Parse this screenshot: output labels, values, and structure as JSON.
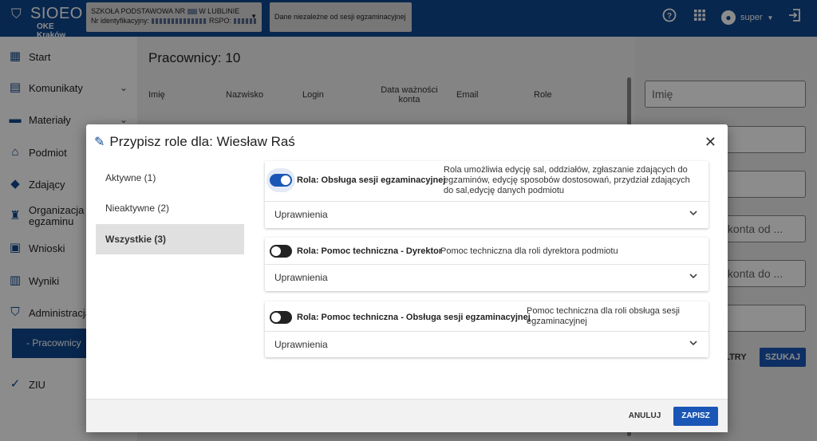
{
  "app": {
    "name": "SIOEO",
    "org": "OKE Kraków",
    "logo_icon": "shield-book-icon"
  },
  "header": {
    "school_line1": "SZKOŁA PODSTAWOWA NR ",
    "school_line1_suffix": " W LUBLINIE",
    "school_line2_prefix": "Nr identyfikacyjny: ",
    "school_line2_rspo": " RSPO: ",
    "exam_selector": "Dane niezależne od sesji egzaminacyjnej",
    "user_name": "super",
    "icons": [
      "help-icon",
      "apps-grid-icon",
      "account-icon",
      "logout-icon"
    ]
  },
  "sidebar": {
    "items": [
      {
        "label": "Start",
        "icon": "dashboard-icon"
      },
      {
        "label": "Komunikaty",
        "icon": "message-icon",
        "expandable": true
      },
      {
        "label": "Materiały",
        "icon": "folder-icon",
        "expandable": true
      },
      {
        "label": "Podmiot",
        "icon": "institution-icon"
      },
      {
        "label": "Zdający",
        "icon": "graduation-cap-icon"
      },
      {
        "label": "Organizacja",
        "label2": "egzaminu",
        "icon": "organization-icon"
      },
      {
        "label": "Wnioski",
        "icon": "clipboard-icon"
      },
      {
        "label": "Wyniki",
        "icon": "bar-chart-icon"
      },
      {
        "label": "Administracja",
        "icon": "shield-admin-icon"
      },
      {
        "label": "ZIU",
        "icon": "verified-icon"
      }
    ],
    "active_sub": "- Pracownicy"
  },
  "main": {
    "title": "Pracownicy: 10",
    "columns": [
      "Imię",
      "Nazwisko",
      "Login",
      "Data ważności konta",
      "Email",
      "Role"
    ]
  },
  "filters": {
    "fields": [
      "Imię",
      "",
      "",
      "Data ważności konta od ...",
      "Data ważności konta do ...",
      ""
    ],
    "clear_button": "WYCZYŚĆ FILTRY",
    "search_button": "SZUKAJ"
  },
  "modal": {
    "title": "Przypisz role dla: Wiesław Raś",
    "tabs": [
      {
        "label": "Aktywne (1)",
        "active": false
      },
      {
        "label": "Nieaktywne (2)",
        "active": false
      },
      {
        "label": "Wszystkie (3)",
        "active": true
      }
    ],
    "roles": [
      {
        "name": "Rola: Obsługa sesji egzaminacyjnej",
        "enabled": true,
        "description": "Rola umożliwia edycję sal, oddziałów, zgłaszanie zdających do egzaminów, edycję sposobów dostosowań, przydział zdających do sal,edycję danych podmiotu",
        "permissions_label": "Uprawnienia"
      },
      {
        "name": "Rola: Pomoc techniczna - Dyrektor",
        "enabled": false,
        "description": "Pomoc techniczna dla roli dyrektora podmiotu",
        "permissions_label": "Uprawnienia"
      },
      {
        "name": "Rola: Pomoc techniczna - Obsługa sesji egzaminacyjnej",
        "enabled": false,
        "description": "Pomoc techniczna dla roli obsługa sesji egzaminacyjnej",
        "permissions_label": "Uprawnienia"
      }
    ],
    "cancel_label": "ANULUJ",
    "save_label": "ZAPISZ"
  },
  "colors": {
    "primary": "#10478e",
    "accent": "#1a56b5"
  }
}
